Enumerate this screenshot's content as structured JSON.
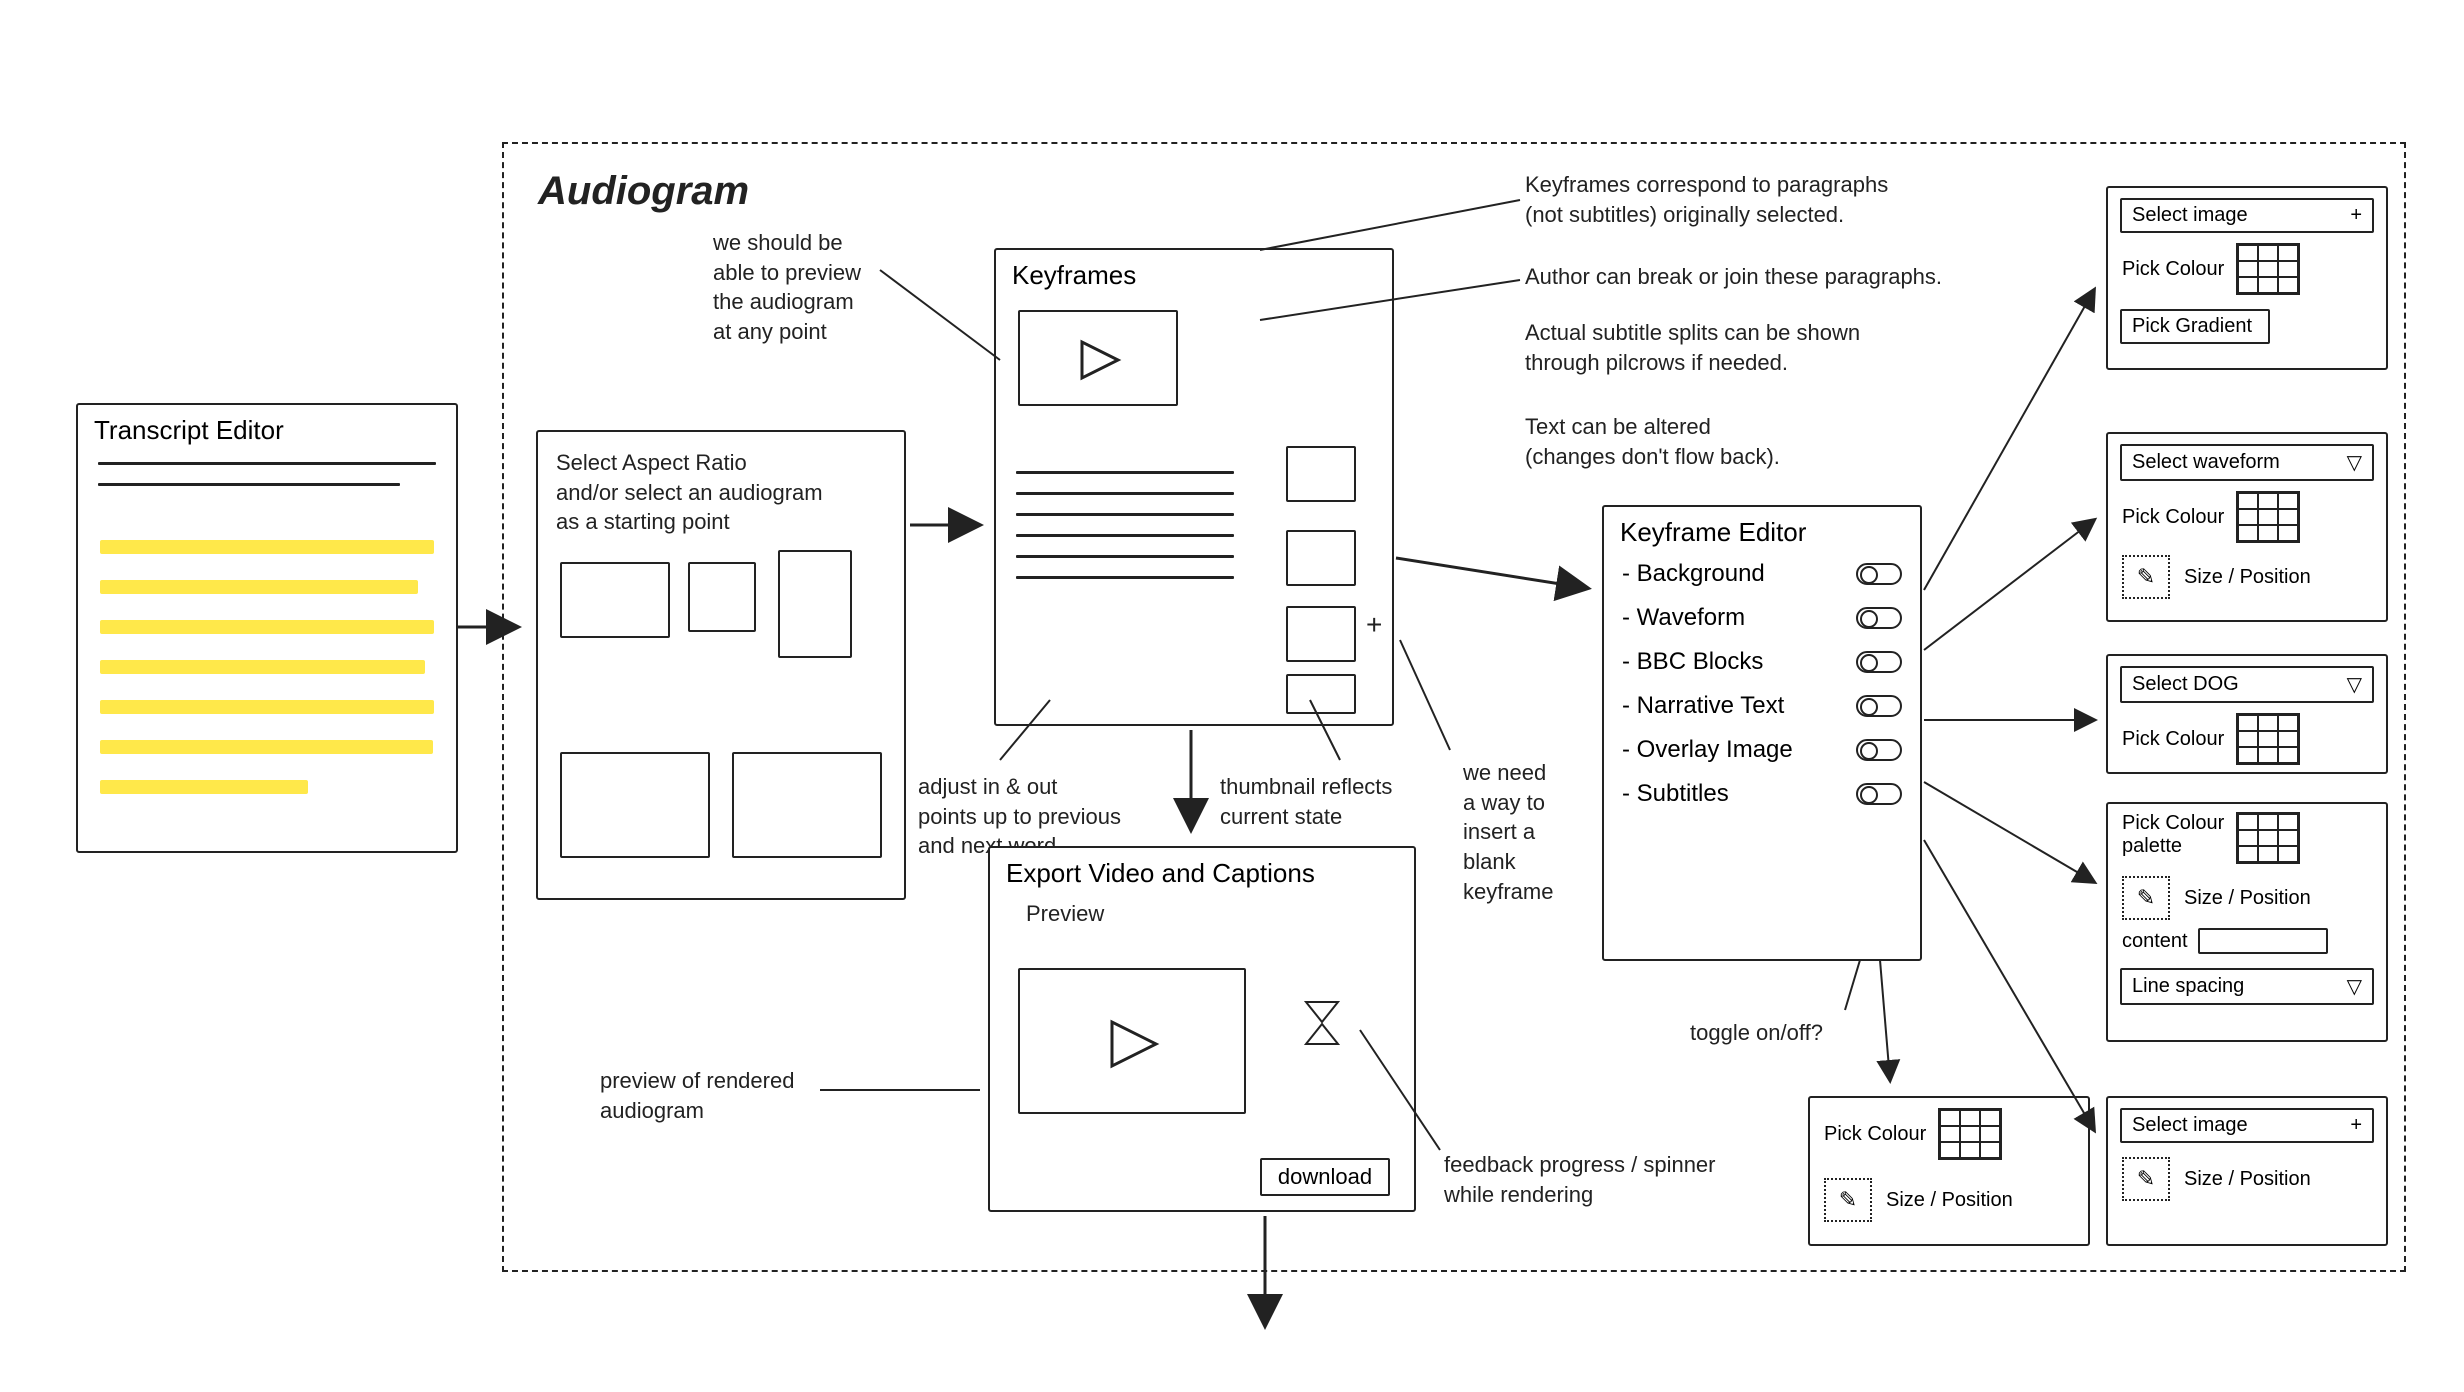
{
  "main_title": "Audiogram",
  "transcript_editor": {
    "title": "Transcript Editor"
  },
  "note_preview": "we should be\nable to preview\nthe audiogram\nat any point",
  "aspect_panel": {
    "text": "Select Aspect Ratio\nand/or select an audiogram\nas a starting point"
  },
  "keyframes": {
    "title": "Keyframes"
  },
  "note_adjust": "adjust in & out\npoints up to previous\nand next word",
  "note_thumbnail": "thumbnail reflects\ncurrent state",
  "note_blank_kf": "we need\na way to\ninsert a\nblank\nkeyframe",
  "notes_right": {
    "l1": "Keyframes correspond to paragraphs\n(not subtitles) originally selected.",
    "l2": "Author can break or join these paragraphs.",
    "l3": "Actual subtitle splits can be shown\nthrough pilcrows if needed.",
    "l4": "Text can be altered\n(changes don't flow back)."
  },
  "keyframe_editor": {
    "title": "Keyframe Editor",
    "items": [
      "Background",
      "Waveform",
      "BBC Blocks",
      "Narrative Text",
      "Overlay Image",
      "Subtitles"
    ]
  },
  "note_toggle": "toggle on/off?",
  "export": {
    "title": "Export Video and Captions",
    "preview": "Preview",
    "download": "download"
  },
  "note_rendered": "preview of rendered\naudiogram",
  "note_feedback": "feedback progress / spinner\nwhile rendering",
  "panel_bg": {
    "select_image": "Select image",
    "pick_colour": "Pick Colour",
    "pick_gradient": "Pick Gradient"
  },
  "panel_waveform": {
    "select": "Select waveform",
    "pick_colour": "Pick Colour",
    "size_pos": "Size / Position"
  },
  "panel_dog": {
    "select": "Select DOG",
    "pick_colour": "Pick Colour"
  },
  "panel_narrative": {
    "pick_colour_palette": "Pick Colour\npalette",
    "size_pos": "Size / Position",
    "content": "content",
    "line_spacing": "Line spacing"
  },
  "panel_overlay": {
    "select_image": "Select image",
    "size_pos": "Size / Position"
  },
  "panel_subtitles": {
    "pick_colour": "Pick Colour",
    "size_pos": "Size / Position"
  },
  "icons": {
    "plus": "+",
    "tri_down": "▽",
    "pencil": "✎"
  }
}
